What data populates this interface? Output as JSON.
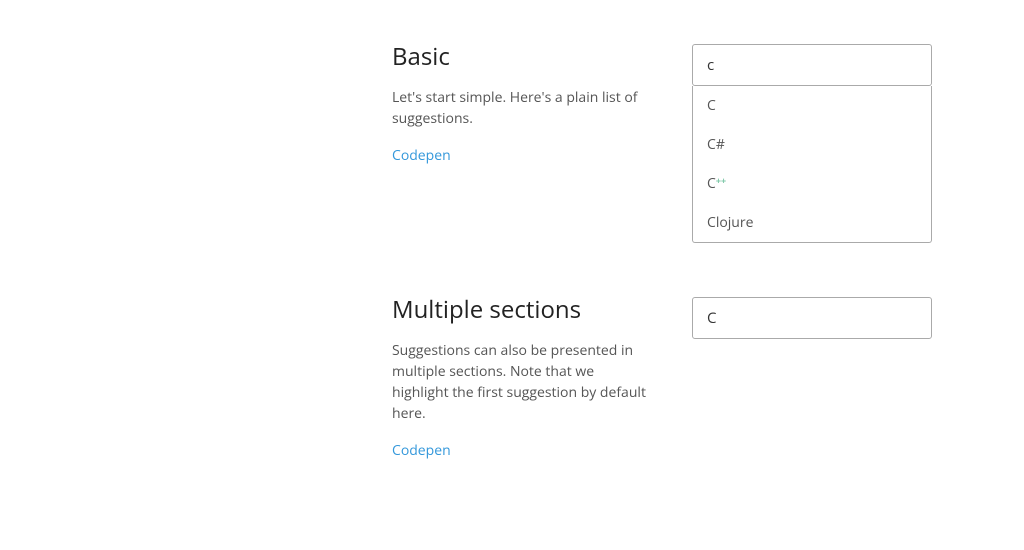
{
  "sections": {
    "basic": {
      "heading": "Basic",
      "description": "Let's start simple. Here's a plain list of suggestions.",
      "link_label": "Codepen",
      "input_value": "c",
      "suggestions": [
        "C",
        "C#",
        "C++",
        "Clojure"
      ]
    },
    "multiple": {
      "heading": "Multiple sections",
      "description": "Suggestions can also be presented in multiple sections. Note that we highlight the first suggestion by default here.",
      "link_label": "Codepen",
      "input_value": "C"
    }
  }
}
